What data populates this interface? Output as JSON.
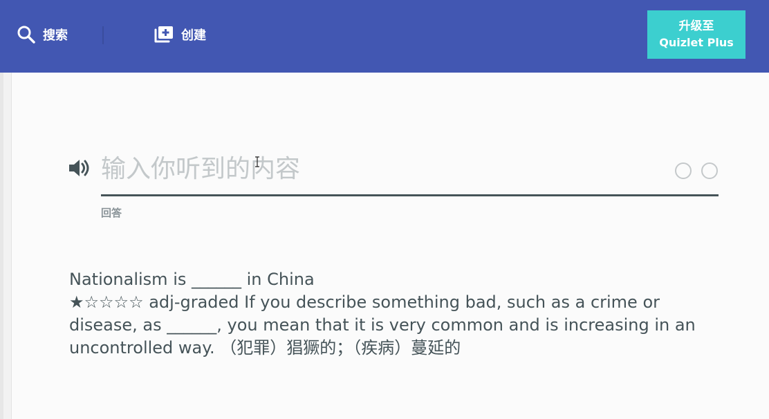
{
  "header": {
    "search_label": "搜索",
    "create_label": "创建",
    "upgrade_line1": "升级至",
    "upgrade_line2": "Quizlet Plus",
    "background_color": "#4257b2",
    "upgrade_color": "#3ccfcf",
    "search_icon": "search-icon",
    "create_icon": "add-set-icon"
  },
  "answer": {
    "placeholder": "输入你听到的内容",
    "value": "",
    "label": "回答",
    "speaker_icon": "speaker-icon"
  },
  "prompt": {
    "lines": [
      "Nationalism is ______ in China",
      "★☆☆☆☆ adj-graded If you describe something bad, such as a crime or",
      "disease, as ______, you mean that it is very common and is increasing in an",
      "uncontrolled way. （犯罪）猖獗的；（疾病）蔓延的"
    ]
  }
}
